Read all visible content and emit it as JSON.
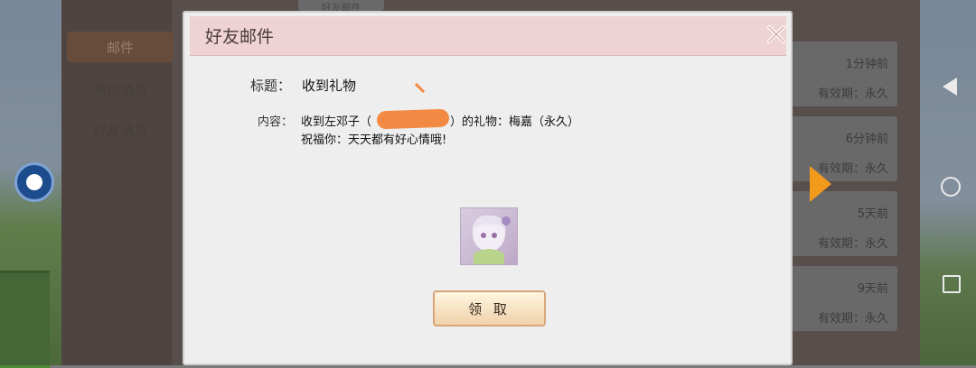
{
  "dialog": {
    "title": "好友邮件",
    "subject_label": "标题：",
    "subject_value": "收到礼物",
    "content_label": "内容：",
    "content_line1": "收到左邓子（",
    "content_line1_tail": "）的礼物：梅嘉（永久）",
    "content_line2": "祝福你：天天都有好心情哦!",
    "claim_button": "领 取"
  },
  "sidebar": {
    "tabs": [
      "邮件",
      "系统消息",
      "好友消息"
    ],
    "top_tab": "好友邮件"
  },
  "mail_list": [
    {
      "time": "1分钟前",
      "validity": "有效期：永久"
    },
    {
      "time": "6分钟前",
      "validity": "有效期：永久"
    },
    {
      "time": "5天前",
      "validity": "有效期：永久"
    },
    {
      "time": "9天前",
      "validity": "有效期：永久"
    }
  ],
  "colors": {
    "header_bg": "#efd2d3",
    "dialog_bg": "#eeeeee",
    "claim_button_border": "#d8a57b",
    "redaction": "#f28a44",
    "arrow": "#f29a1c"
  }
}
